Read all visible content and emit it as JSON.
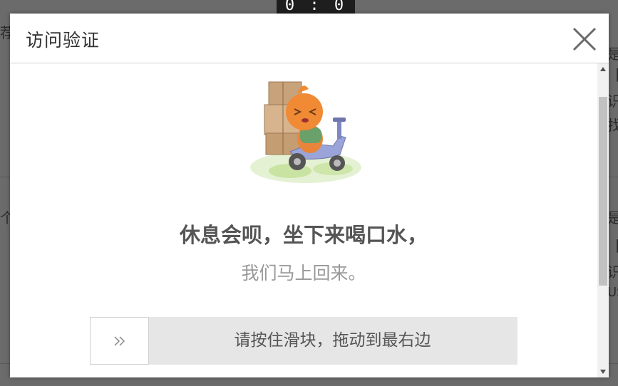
{
  "background": {
    "counter_text": "0 : 0",
    "fragments": [
      "荐",
      "个",
      "是",
      "【",
      "识",
      "找",
      "是",
      "【",
      "识",
      "US"
    ]
  },
  "modal": {
    "title": "访问验证",
    "close_icon": "close-icon",
    "illustration": "delivery-scooter-character-illustration",
    "headline": "休息会呗，坐下来喝口水，",
    "subline": "我们马上回来。",
    "slider": {
      "handle_icon": "double-chevron-right-icon",
      "handle_glyph": "››",
      "label": "请按住滑块，拖动到最右边"
    }
  },
  "colors": {
    "overlay": "#6b6b6b",
    "modal_bg": "#ffffff",
    "headline": "#555555",
    "subline": "#999999",
    "slider_track": "#e6e6e6"
  }
}
